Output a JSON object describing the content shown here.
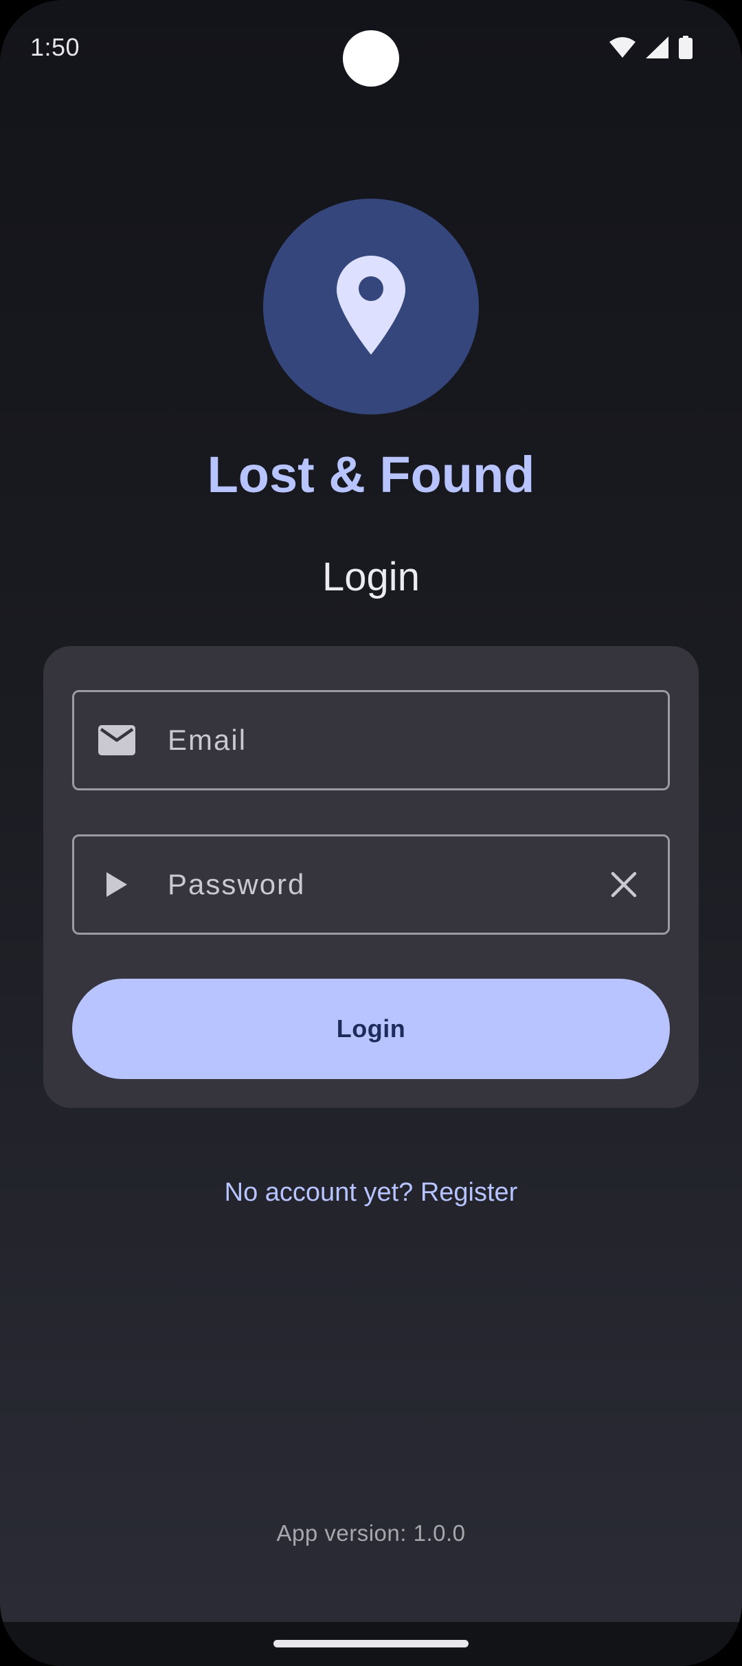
{
  "status_bar": {
    "time": "1:50",
    "icons": [
      "wifi-icon",
      "signal-icon",
      "battery-icon"
    ]
  },
  "app": {
    "title": "Lost & Found",
    "logo_icon": "location-pin-icon"
  },
  "screen": {
    "title": "Login"
  },
  "form": {
    "email": {
      "placeholder": "Email",
      "value": "",
      "icon": "mail-icon"
    },
    "password": {
      "placeholder": "Password",
      "value": "",
      "icon": "play-icon",
      "trailing_icon": "close-icon"
    },
    "login_label": "Login"
  },
  "register_link": "No account yet? Register",
  "footer": {
    "version": "App version: 1.0.0"
  },
  "colors": {
    "accent": "#b7c4ff",
    "logo_bg": "#34467b",
    "card_bg": "#36353d",
    "button_text": "#1d2a5a"
  }
}
